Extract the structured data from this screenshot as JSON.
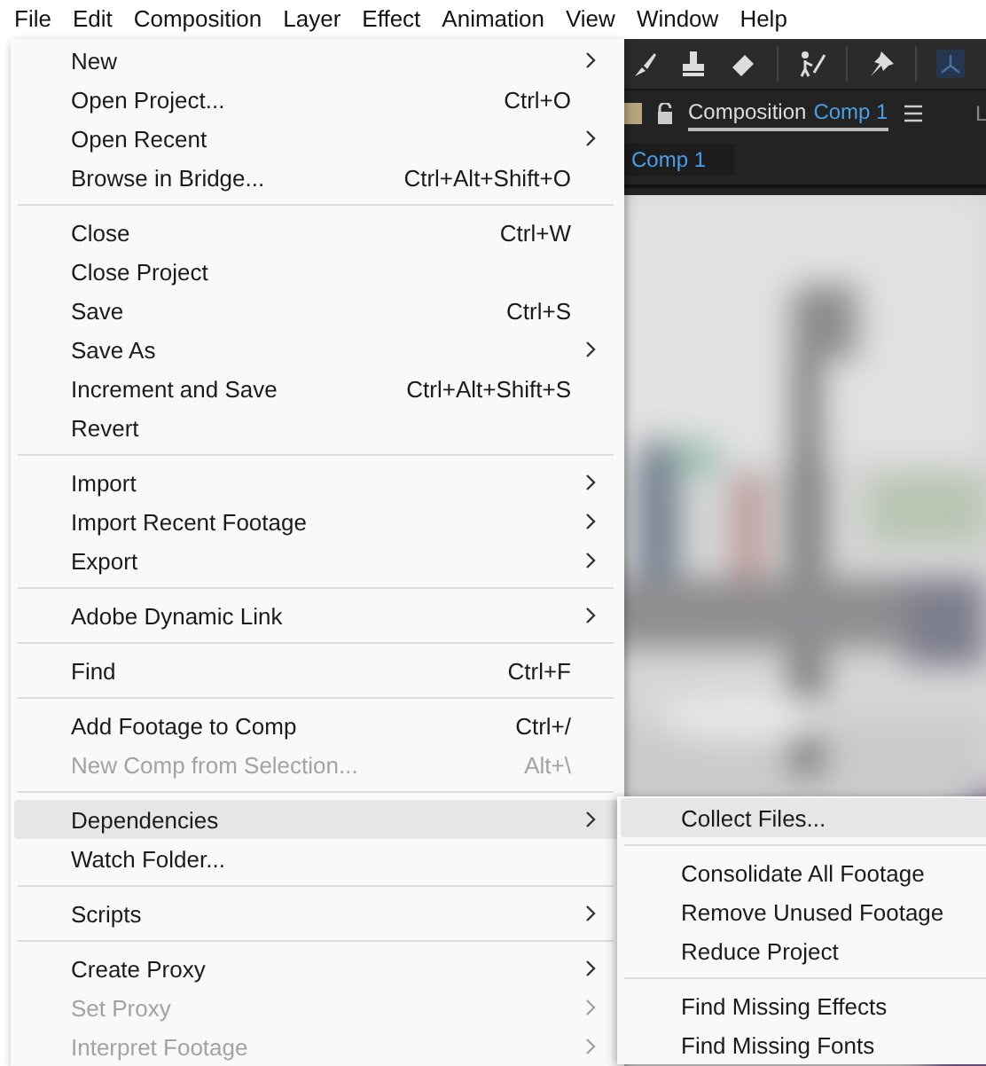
{
  "menu_bar": [
    "File",
    "Edit",
    "Composition",
    "Layer",
    "Effect",
    "Animation",
    "View",
    "Window",
    "Help"
  ],
  "composition_panel": {
    "tab_label": "Composition",
    "comp_name": "Comp 1",
    "next_tab_label": "L",
    "viewer_tab": "Comp 1"
  },
  "file_menu": [
    {
      "kind": "item",
      "label": "New",
      "submenu": true,
      "disabled": false,
      "selected": false
    },
    {
      "kind": "item",
      "label": "Open Project...",
      "shortcut": "Ctrl+O",
      "disabled": false,
      "selected": false
    },
    {
      "kind": "item",
      "label": "Open Recent",
      "submenu": true,
      "disabled": false,
      "selected": false
    },
    {
      "kind": "item",
      "label": "Browse in Bridge...",
      "shortcut": "Ctrl+Alt+Shift+O",
      "disabled": false,
      "selected": false
    },
    {
      "kind": "separator"
    },
    {
      "kind": "item",
      "label": "Close",
      "shortcut": "Ctrl+W",
      "disabled": false,
      "selected": false
    },
    {
      "kind": "item",
      "label": "Close Project",
      "disabled": false,
      "selected": false
    },
    {
      "kind": "item",
      "label": "Save",
      "shortcut": "Ctrl+S",
      "disabled": false,
      "selected": false
    },
    {
      "kind": "item",
      "label": "Save As",
      "submenu": true,
      "disabled": false,
      "selected": false
    },
    {
      "kind": "item",
      "label": "Increment and Save",
      "shortcut": "Ctrl+Alt+Shift+S",
      "disabled": false,
      "selected": false
    },
    {
      "kind": "item",
      "label": "Revert",
      "disabled": false,
      "selected": false
    },
    {
      "kind": "separator"
    },
    {
      "kind": "item",
      "label": "Import",
      "submenu": true,
      "disabled": false,
      "selected": false
    },
    {
      "kind": "item",
      "label": "Import Recent Footage",
      "submenu": true,
      "disabled": false,
      "selected": false
    },
    {
      "kind": "item",
      "label": "Export",
      "submenu": true,
      "disabled": false,
      "selected": false
    },
    {
      "kind": "separator"
    },
    {
      "kind": "item",
      "label": "Adobe Dynamic Link",
      "submenu": true,
      "disabled": false,
      "selected": false
    },
    {
      "kind": "separator"
    },
    {
      "kind": "item",
      "label": "Find",
      "shortcut": "Ctrl+F",
      "disabled": false,
      "selected": false
    },
    {
      "kind": "separator"
    },
    {
      "kind": "item",
      "label": "Add Footage to Comp",
      "shortcut": "Ctrl+/",
      "disabled": false,
      "selected": false
    },
    {
      "kind": "item",
      "label": "New Comp from Selection...",
      "shortcut": "Alt+\\",
      "disabled": true,
      "selected": false
    },
    {
      "kind": "separator"
    },
    {
      "kind": "item",
      "label": "Dependencies",
      "submenu": true,
      "disabled": false,
      "selected": true
    },
    {
      "kind": "item",
      "label": "Watch Folder...",
      "disabled": false,
      "selected": false
    },
    {
      "kind": "separator"
    },
    {
      "kind": "item",
      "label": "Scripts",
      "submenu": true,
      "disabled": false,
      "selected": false
    },
    {
      "kind": "separator"
    },
    {
      "kind": "item",
      "label": "Create Proxy",
      "submenu": true,
      "disabled": false,
      "selected": false
    },
    {
      "kind": "item",
      "label": "Set Proxy",
      "submenu": true,
      "disabled": true,
      "selected": false
    },
    {
      "kind": "item",
      "label": "Interpret Footage",
      "submenu": true,
      "disabled": true,
      "selected": false
    }
  ],
  "dependencies_submenu": [
    {
      "kind": "item",
      "label": "Collect Files...",
      "disabled": false,
      "selected": true
    },
    {
      "kind": "separator"
    },
    {
      "kind": "item",
      "label": "Consolidate All Footage",
      "disabled": false,
      "selected": false
    },
    {
      "kind": "item",
      "label": "Remove Unused Footage",
      "disabled": false,
      "selected": false
    },
    {
      "kind": "item",
      "label": "Reduce Project",
      "disabled": false,
      "selected": false
    },
    {
      "kind": "separator"
    },
    {
      "kind": "item",
      "label": "Find Missing Effects",
      "disabled": false,
      "selected": false
    },
    {
      "kind": "item",
      "label": "Find Missing Fonts",
      "disabled": false,
      "selected": false
    }
  ]
}
